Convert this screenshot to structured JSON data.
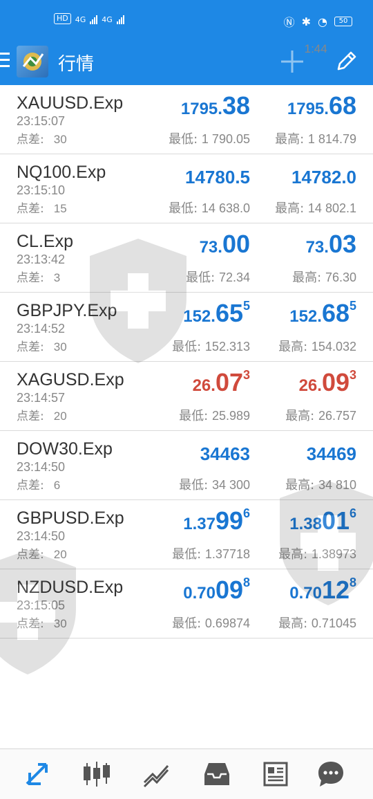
{
  "status_bar": {
    "left_badges": [
      "HD",
      "4G",
      "4G"
    ],
    "battery": "50",
    "time": "1:44"
  },
  "app_bar": {
    "title": "行情",
    "icons": [
      "menu-icon",
      "metatrader-logo-icon",
      "plus-icon",
      "edit-icon"
    ]
  },
  "quotes": [
    {
      "symbol": "XAUUSD.Exp",
      "time": "23:15:07",
      "spread_label": "点差:",
      "spread": "30",
      "color": "blue",
      "bid": {
        "p1": "1795.",
        "p2": "38",
        "p3": ""
      },
      "ask": {
        "p1": "1795.",
        "p2": "68",
        "p3": ""
      },
      "low_label": "最低:",
      "low": "1 790.05",
      "high_label": "最高:",
      "high": "1 814.79"
    },
    {
      "symbol": "NQ100.Exp",
      "time": "23:15:10",
      "spread_label": "点差:",
      "spread": "15",
      "color": "blue",
      "bid": {
        "p1": "14780.5",
        "p2": "",
        "p3": ""
      },
      "ask": {
        "p1": "14782.0",
        "p2": "",
        "p3": ""
      },
      "low_label": "最低:",
      "low": "14 638.0",
      "high_label": "最高:",
      "high": "14 802.1"
    },
    {
      "symbol": "CL.Exp",
      "time": "23:13:42",
      "spread_label": "点差:",
      "spread": "3",
      "color": "blue",
      "bid": {
        "p1": "73.",
        "p2": "00",
        "p3": ""
      },
      "ask": {
        "p1": "73.",
        "p2": "03",
        "p3": ""
      },
      "low_label": "最低:",
      "low": "72.34",
      "high_label": "最高:",
      "high": "76.30"
    },
    {
      "symbol": "GBPJPY.Exp",
      "time": "23:14:52",
      "spread_label": "点差:",
      "spread": "30",
      "color": "blue",
      "bid": {
        "p1": "152.",
        "p2": "65",
        "p3": "5"
      },
      "ask": {
        "p1": "152.",
        "p2": "68",
        "p3": "5"
      },
      "low_label": "最低:",
      "low": "152.313",
      "high_label": "最高:",
      "high": "154.032"
    },
    {
      "symbol": "XAGUSD.Exp",
      "time": "23:14:57",
      "spread_label": "点差:",
      "spread": "20",
      "color": "red",
      "bid": {
        "p1": "26.",
        "p2": "07",
        "p3": "3"
      },
      "ask": {
        "p1": "26.",
        "p2": "09",
        "p3": "3"
      },
      "low_label": "最低:",
      "low": "25.989",
      "high_label": "最高:",
      "high": "26.757"
    },
    {
      "symbol": "DOW30.Exp",
      "time": "23:14:50",
      "spread_label": "点差:",
      "spread": "6",
      "color": "blue",
      "bid": {
        "p1": "34463",
        "p2": "",
        "p3": ""
      },
      "ask": {
        "p1": "34469",
        "p2": "",
        "p3": ""
      },
      "low_label": "最低:",
      "low": "34 300",
      "high_label": "最高:",
      "high": "34 810"
    },
    {
      "symbol": "GBPUSD.Exp",
      "time": "23:14:50",
      "spread_label": "点差:",
      "spread": "20",
      "color": "blue",
      "bid": {
        "p1": "1.37",
        "p2": "99",
        "p3": "6"
      },
      "ask": {
        "p1": "1.38",
        "p2": "01",
        "p3": "6"
      },
      "low_label": "最低:",
      "low": "1.37718",
      "high_label": "最高:",
      "high": "1.38973"
    },
    {
      "symbol": "NZDUSD.Exp",
      "time": "23:15:05",
      "spread_label": "点差:",
      "spread": "30",
      "color": "blue",
      "bid": {
        "p1": "0.70",
        "p2": "09",
        "p3": "8"
      },
      "ask": {
        "p1": "0.70",
        "p2": "12",
        "p3": "8"
      },
      "low_label": "最低:",
      "low": "0.69874",
      "high_label": "最高:",
      "high": "0.71045"
    }
  ],
  "bottom_nav": {
    "items": [
      "quotes-icon",
      "chart-icon",
      "trade-icon",
      "history-icon",
      "news-icon",
      "chat-icon"
    ]
  },
  "colors": {
    "app_bar": "#1e88e5",
    "price_up": "#1976d2",
    "price_down": "#d04a3c",
    "muted_text": "#888888",
    "active_nav": "#1e88e5",
    "inactive_nav": "#555555"
  }
}
